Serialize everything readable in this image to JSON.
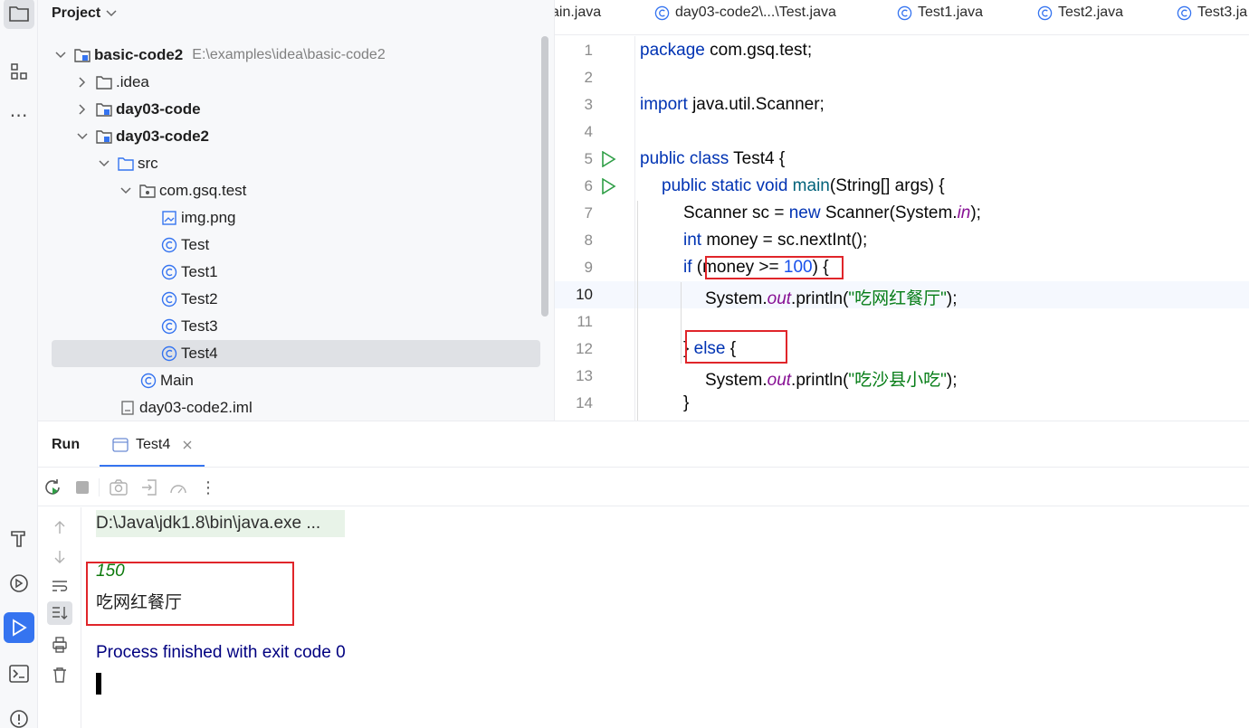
{
  "project": {
    "title": "Project",
    "tree": [
      {
        "label": "basic-code2",
        "path": "E:\\examples\\idea\\basic-code2"
      },
      {
        "label": ".idea"
      },
      {
        "label": "day03-code"
      },
      {
        "label": "day03-code2"
      },
      {
        "label": "src"
      },
      {
        "label": "com.gsq.test"
      },
      {
        "label": "img.png"
      },
      {
        "label": "Test"
      },
      {
        "label": "Test1"
      },
      {
        "label": "Test2"
      },
      {
        "label": "Test3"
      },
      {
        "label": "Test4"
      },
      {
        "label": "Main"
      },
      {
        "label": "day03-code2.iml"
      }
    ]
  },
  "editor": {
    "tabs": [
      "ain.java",
      "day03-code2\\...\\Test.java",
      "Test1.java",
      "Test2.java",
      "Test3.ja"
    ],
    "line_numbers": [
      "1",
      "2",
      "3",
      "4",
      "5",
      "6",
      "7",
      "8",
      "9",
      "10",
      "11",
      "12",
      "13",
      "14"
    ],
    "code": {
      "l1_kw": "package",
      "l1_rest": " com.gsq.test;",
      "l3_kw": "import",
      "l3_rest": " java.util.Scanner;",
      "l5_kw": "public class",
      "l5_rest": " Test4 {",
      "l6_kw": "public static void",
      "l6_mth": " main",
      "l6_rest": "(String[] args) {",
      "l7_a": "Scanner sc = ",
      "l7_kw": "new",
      "l7_b": " Scanner(System.",
      "l7_fld": "in",
      "l7_c": ");",
      "l8_kw": "int",
      "l8_rest": " money = sc.nextInt();",
      "l9_kw": "if",
      "l9_a": " (money >= ",
      "l9_num": "100",
      "l9_b": ") {",
      "l10_a": "System.",
      "l10_fld": "out",
      "l10_b": ".println(",
      "l10_str": "\"吃网红餐厅\"",
      "l10_c": ");",
      "l12_a": "} ",
      "l12_kw": "else",
      "l12_b": " {",
      "l13_a": "System.",
      "l13_fld": "out",
      "l13_b": ".println(",
      "l13_str": "\"吃沙县小吃\"",
      "l13_c": ");",
      "l14": "}"
    }
  },
  "run": {
    "title": "Run",
    "tab": "Test4",
    "command": "D:\\Java\\jdk1.8\\bin\\java.exe ...",
    "input": "150",
    "output": "吃网红餐厅",
    "finished": "Process finished with exit code 0"
  },
  "colors": {
    "accent": "#3574f0",
    "highlight_box": "#e0252a",
    "keyword": "#0033b3",
    "string": "#067d17"
  }
}
